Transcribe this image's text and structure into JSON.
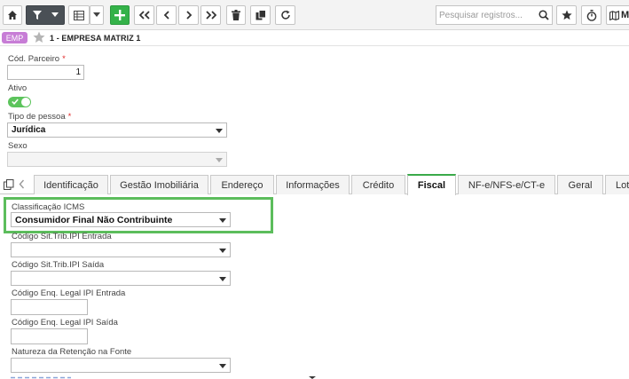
{
  "toolbar": {
    "search_placeholder": "Pesquisar registros...",
    "m_label": "M",
    "icons": [
      "home-icon",
      "filter-icon",
      "grid-icon",
      "add-icon",
      "first-icon",
      "prev-icon",
      "next-icon",
      "last-icon",
      "delete-icon",
      "copy-icon",
      "refresh-icon",
      "search-icon",
      "star-icon",
      "timer-icon",
      "map-icon"
    ]
  },
  "record": {
    "badge": "EMP",
    "title": "1 - EMPRESA MATRIZ 1"
  },
  "fields": {
    "cod_parceiro_label": "Cód. Parceiro",
    "cod_parceiro_value": "1",
    "required_mark": "*",
    "ativo_label": "Ativo",
    "ativo_value": true,
    "tipo_pessoa_label": "Tipo de pessoa",
    "tipo_pessoa_value": "Jurídica",
    "sexo_label": "Sexo",
    "sexo_value": ""
  },
  "tabs": [
    {
      "label": "Identificação",
      "active": false
    },
    {
      "label": "Gestão Imobiliária",
      "active": false
    },
    {
      "label": "Endereço",
      "active": false
    },
    {
      "label": "Informações",
      "active": false
    },
    {
      "label": "Crédito",
      "active": false
    },
    {
      "label": "Fiscal",
      "active": true
    },
    {
      "label": "NF-e/NFS-e/CT-e",
      "active": false
    },
    {
      "label": "Geral",
      "active": false
    },
    {
      "label": "Lot",
      "active": false
    }
  ],
  "fiscal": {
    "classificacao_icms_label": "Classificação ICMS",
    "classificacao_icms_value": "Consumidor Final Não Contribuinte",
    "cod_sit_trib_ipi_entrada_label": "Código Sit.Trib.IPI Entrada",
    "cod_sit_trib_ipi_saida_label": "Código Sit.Trib.IPI Saída",
    "cod_enq_legal_ipi_entrada_label": "Código Enq. Legal IPI Entrada",
    "cod_enq_legal_ipi_saida_label": "Código Enq. Legal IPI Saída",
    "natureza_retencao_label": "Natureza da Retenção na Fonte"
  },
  "colors": {
    "accent_green": "#34b249",
    "highlight_green": "#5cbd5c",
    "badge_purple": "#c77dd6",
    "required_red": "#e12b2b"
  }
}
